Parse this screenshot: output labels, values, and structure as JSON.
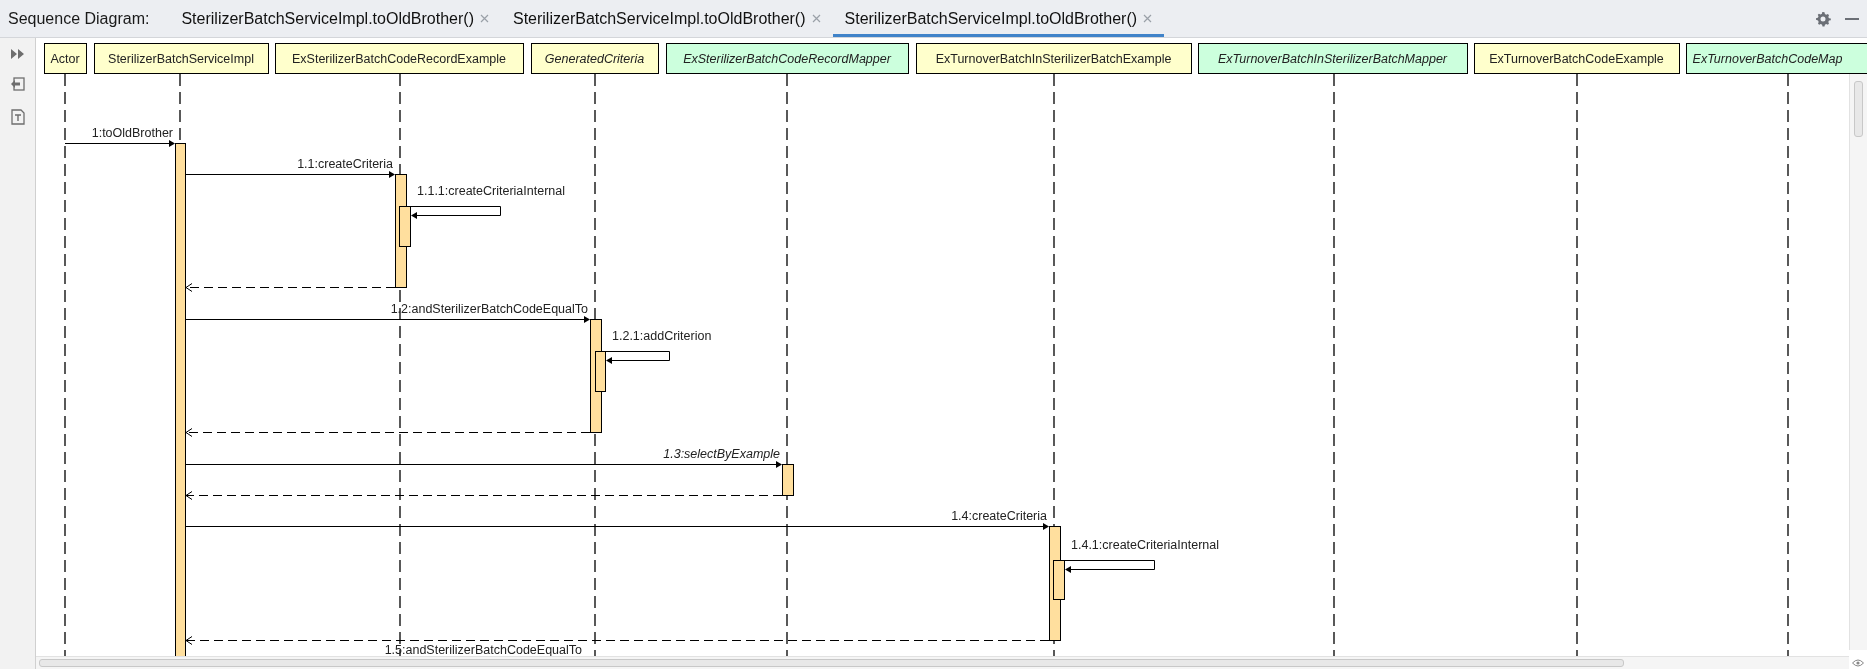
{
  "header": {
    "title": "Sequence Diagram:"
  },
  "tabs": [
    {
      "label": "SterilizerBatchServiceImpl.toOldBrother()",
      "selected": false
    },
    {
      "label": "SterilizerBatchServiceImpl.toOldBrother()",
      "selected": false
    },
    {
      "label": "SterilizerBatchServiceImpl.toOldBrother()",
      "selected": true
    }
  ],
  "participants": [
    {
      "name": "Actor",
      "kind": "class"
    },
    {
      "name": "SterilizerBatchServiceImpl",
      "kind": "class"
    },
    {
      "name": "ExSterilizerBatchCodeRecordExample",
      "kind": "class"
    },
    {
      "name": "GeneratedCriteria",
      "kind": "abstract"
    },
    {
      "name": "ExSterilizerBatchCodeRecordMapper",
      "kind": "interface"
    },
    {
      "name": "ExTurnoverBatchInSterilizerBatchExample",
      "kind": "class"
    },
    {
      "name": "ExTurnoverBatchInSterilizerBatchMapper",
      "kind": "interface"
    },
    {
      "name": "ExTurnoverBatchCodeExample",
      "kind": "class"
    },
    {
      "name": "ExTurnoverBatchCodeMap",
      "kind": "interface"
    }
  ],
  "messages": [
    {
      "kind": "call",
      "label": "1:toOldBrother",
      "italic": false
    },
    {
      "kind": "call",
      "label": "1.1:createCriteria",
      "italic": false
    },
    {
      "kind": "self",
      "label": "1.1.1:createCriteriaInternal",
      "italic": false
    },
    {
      "kind": "return"
    },
    {
      "kind": "call",
      "label": "1.2:andSterilizerBatchCodeEqualTo",
      "italic": false
    },
    {
      "kind": "self",
      "label": "1.2.1:addCriterion",
      "italic": false
    },
    {
      "kind": "return"
    },
    {
      "kind": "call",
      "label": "1.3:selectByExample",
      "italic": true
    },
    {
      "kind": "return"
    },
    {
      "kind": "call",
      "label": "1.4:createCriteria",
      "italic": false
    },
    {
      "kind": "self",
      "label": "1.4.1:createCriteriaInternal",
      "italic": false
    },
    {
      "kind": "return"
    },
    {
      "kind": "call",
      "label": "1.5:andSterilizerBatchCodeEqualTo",
      "italic": false
    }
  ]
}
